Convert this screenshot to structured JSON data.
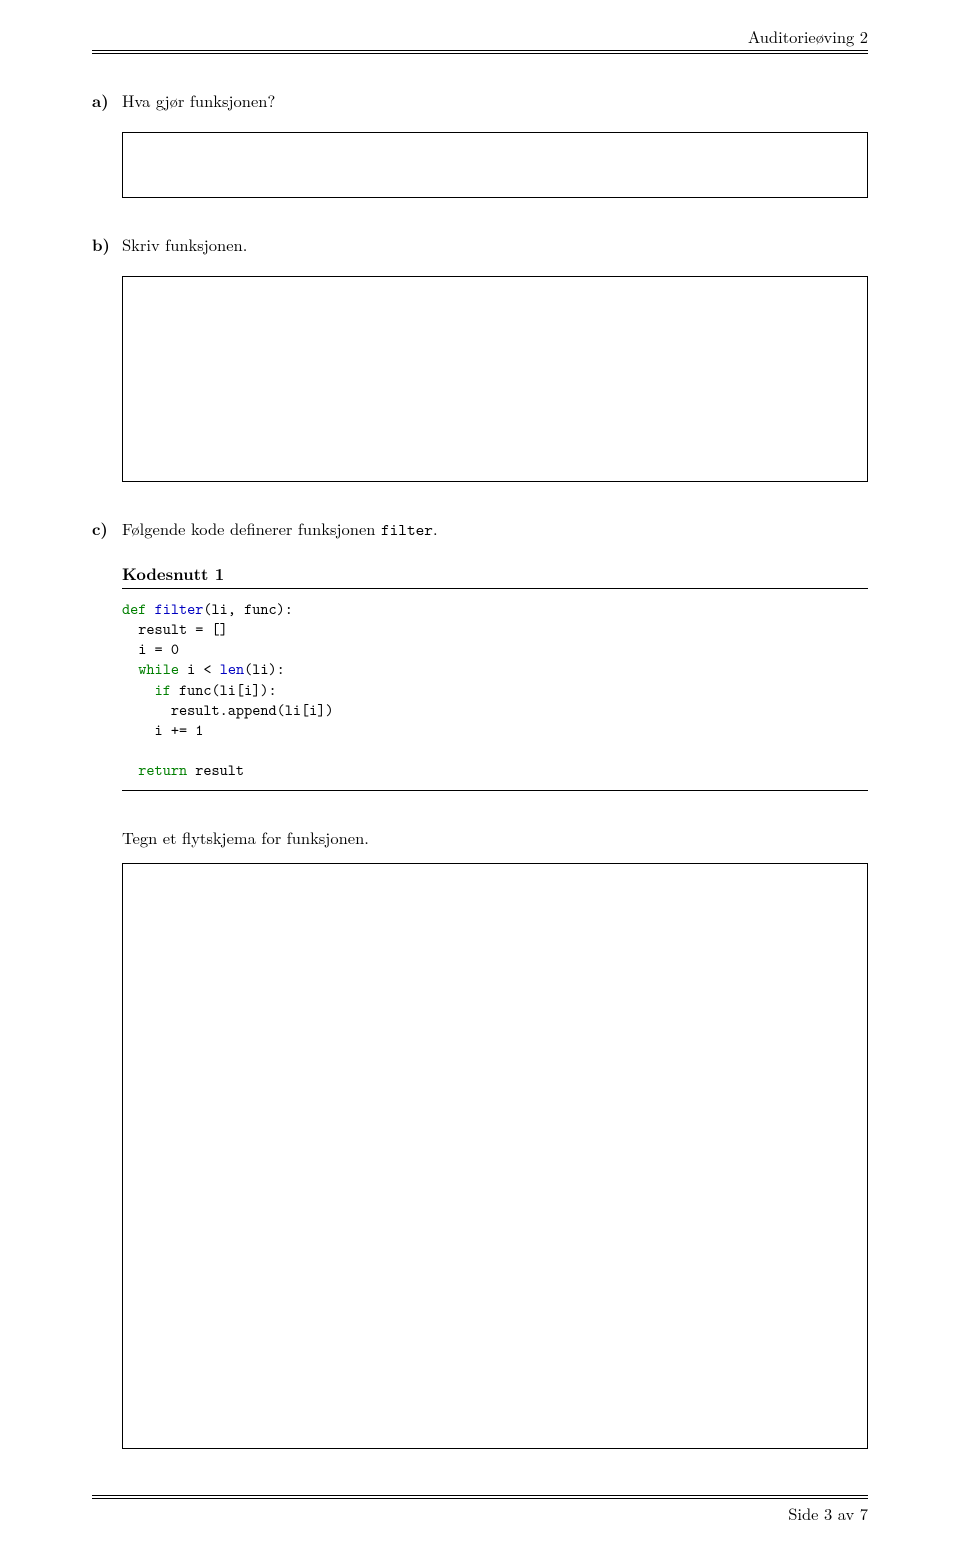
{
  "header": {
    "title": "Auditorieøving 2"
  },
  "questions": {
    "a": {
      "label": "a)",
      "text": "Hva gjør funksjonen?"
    },
    "b": {
      "label": "b)",
      "text": "Skriv funksjonen."
    },
    "c": {
      "label": "c)",
      "text_pre": "Følgende kode definerer funksjonen ",
      "text_code": "filter",
      "text_post": "."
    }
  },
  "snippet": {
    "label": "Kodesnutt 1",
    "code": {
      "l1_kw": "def",
      "l1_fn": "filter",
      "l1_rest": "(li, func):",
      "l2": "  result = []",
      "l3": "  i = 0",
      "l4_ind": "  ",
      "l4_kw": "while",
      "l4_rest": " i < ",
      "l4_fn": "len",
      "l4_end": "(li):",
      "l5_ind": "    ",
      "l5_kw": "if",
      "l5_rest": " func(li[i]):",
      "l6": "      result.append(li[i])",
      "l7": "    i += 1",
      "l8": "",
      "l9_ind": "  ",
      "l9_kw": "return",
      "l9_rest": " result"
    }
  },
  "post_snippet": "Tegn et flytskjema for funksjonen.",
  "footer": {
    "text": "Side 3 av 7"
  }
}
